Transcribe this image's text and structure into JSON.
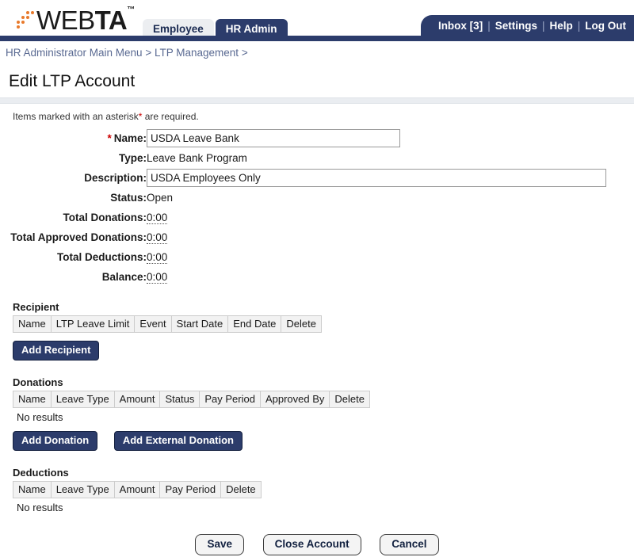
{
  "header": {
    "logo": {
      "text_light": "WEB",
      "text_bold": "TA",
      "trademark": "™",
      "dot_color": "#e8792b"
    },
    "tabs": [
      {
        "label": "Employee",
        "active": false
      },
      {
        "label": "HR Admin",
        "active": true
      }
    ],
    "user_links": [
      {
        "label": "Inbox [3]"
      },
      {
        "label": "Settings"
      },
      {
        "label": "Help"
      },
      {
        "label": "Log Out"
      }
    ],
    "link_separator": "|",
    "accent_navy": "#2c3c6b"
  },
  "breadcrumb": {
    "items": [
      {
        "label": "HR Administrator Main Menu"
      },
      {
        "label": "LTP Management"
      }
    ],
    "separator": ">",
    "trailing_separator": ">"
  },
  "page": {
    "title": "Edit LTP Account",
    "required_note_prefix": "Items marked with an asterisk",
    "required_note_asterisk": "*",
    "required_note_suffix": " are required."
  },
  "form": {
    "name": {
      "label": "Name:",
      "asterisk": "*",
      "value": "USDA Leave Bank"
    },
    "type": {
      "label": "Type:",
      "value": "Leave Bank Program"
    },
    "description": {
      "label": "Description:",
      "value": "USDA Employees Only"
    },
    "status": {
      "label": "Status:",
      "value": "Open"
    },
    "total_donations": {
      "label": "Total Donations:",
      "value": "0:00"
    },
    "total_approved_donations": {
      "label": "Total Approved Donations:",
      "value": "0:00"
    },
    "total_deductions": {
      "label": "Total Deductions:",
      "value": "0:00"
    },
    "balance": {
      "label": "Balance:",
      "value": "0:00"
    }
  },
  "recipient_section": {
    "title": "Recipient",
    "columns": [
      "Name",
      "LTP Leave Limit",
      "Event",
      "Start Date",
      "End Date",
      "Delete"
    ],
    "rows": [],
    "buttons": [
      {
        "label": "Add Recipient"
      }
    ]
  },
  "donations_section": {
    "title": "Donations",
    "columns": [
      "Name",
      "Leave Type",
      "Amount",
      "Status",
      "Pay Period",
      "Approved By",
      "Delete"
    ],
    "rows": [],
    "empty_text": "No results",
    "buttons": [
      {
        "label": "Add Donation"
      },
      {
        "label": "Add External Donation"
      }
    ]
  },
  "deductions_section": {
    "title": "Deductions",
    "columns": [
      "Name",
      "Leave Type",
      "Amount",
      "Pay Period",
      "Delete"
    ],
    "rows": [],
    "empty_text": "No results"
  },
  "footer": {
    "buttons": [
      {
        "label": "Save"
      },
      {
        "label": "Close Account"
      },
      {
        "label": "Cancel"
      }
    ]
  }
}
